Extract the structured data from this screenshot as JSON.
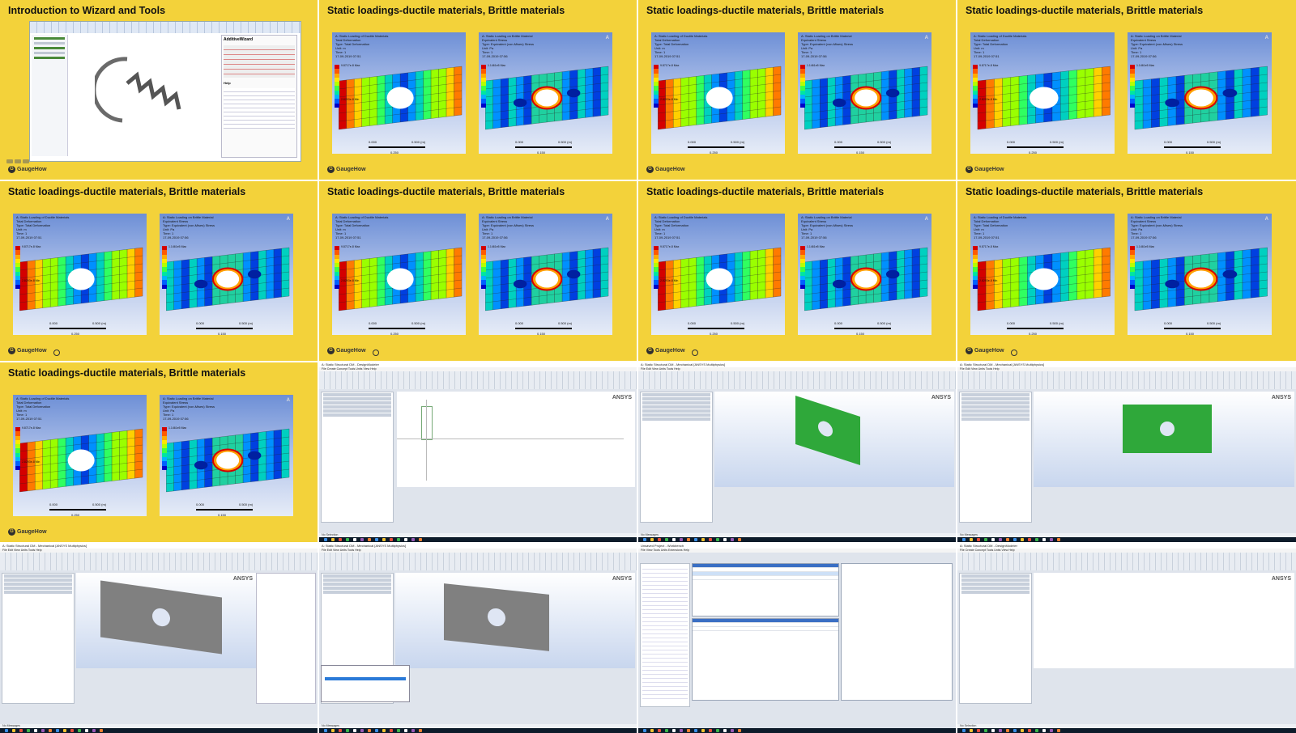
{
  "grid": {
    "tiles": [
      {
        "title": "Introduction to Wizard and Tools"
      },
      {
        "title": "Static loadings-ductile materials, Brittle materials"
      },
      {
        "title": "Static loadings-ductile materials, Brittle materials"
      },
      {
        "title": "Static loadings-ductile materials, Brittle materials"
      },
      {
        "title": "Static loadings-ductile materials, Brittle materials"
      },
      {
        "title": "Static loadings-ductile materials, Brittle materials"
      },
      {
        "title": "Static loadings-ductile materials, Brittle materials"
      },
      {
        "title": "Static loadings-ductile materials, Brittle materials"
      },
      {
        "title": "Static loadings-ductile materials, Brittle materials"
      }
    ]
  },
  "brand": {
    "logo_text": "GaugeHow",
    "ansys": "ANSYS"
  },
  "panels": {
    "ductile_title": "A: Static Loading of Ductile Materials\nTotal Deformation\nType: Total Deformation\nUnit: m\nTime: 1\n17-09-2019 07:51",
    "ductile_max": "9.8717e-8 Max",
    "ductile_min": "2.8293e-8 Min",
    "brittle_title": "A: Static Loading on Brittle Material\nEquivalent Stress\nType: Equivalent (von-Mises) Stress\nUnit: Pa\nTime: 1\n17-09-2019 07:56",
    "brittle_max": "1.1461e5 Max",
    "scale_left": "0.000",
    "scale_right": "0.500 (m)",
    "scale_mid": "0.250",
    "scale_mid_b": "0.150"
  },
  "apps": {
    "dm_title": "A: Static Structural DM - DesignModeler",
    "mech_title": "A: Static Structural DM - Mechanical [ANSYS Multiphysics]",
    "wb_title": "Unsaved Project - Workbench",
    "status_messages": "No Messages",
    "status_selection": "No Selection",
    "wizard_title": "AdditiveWizard",
    "wizard_section": "Help"
  },
  "colors": {
    "tile_yellow": "#f3d23a",
    "plate_green": "#2fa83a",
    "plate_gray": "#808080",
    "legend": [
      "#d40000",
      "#ff5a00",
      "#ffaa00",
      "#ffe600",
      "#b5ff00",
      "#40ff40",
      "#00e6a0",
      "#00b4ff",
      "#0060ff",
      "#0000c8"
    ]
  }
}
